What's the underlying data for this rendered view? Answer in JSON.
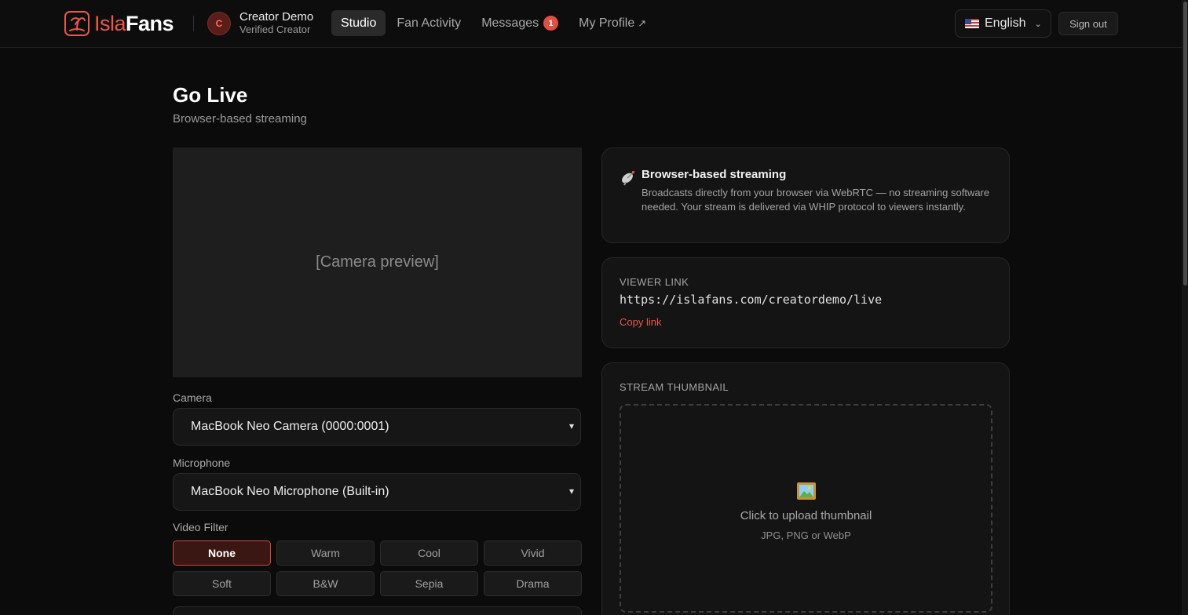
{
  "brand": {
    "part1": "Isla",
    "part2": "Fans"
  },
  "user": {
    "initial": "C",
    "name": "Creator Demo",
    "role": "Verified Creator"
  },
  "nav": {
    "studio": "Studio",
    "fan_activity": "Fan Activity",
    "messages": "Messages",
    "messages_count": "1",
    "my_profile": "My Profile",
    "external_arrow": "↗"
  },
  "language": {
    "selected": "English"
  },
  "signout": "Sign out",
  "page": {
    "title": "Go Live",
    "subtitle": "Browser-based streaming"
  },
  "preview": {
    "placeholder": "[Camera preview]"
  },
  "camera": {
    "label": "Camera",
    "selected": "MacBook Neo Camera (0000:0001)"
  },
  "microphone": {
    "label": "Microphone",
    "selected": "MacBook Neo Microphone (Built-in)"
  },
  "video_filter": {
    "label": "Video Filter",
    "options": [
      "None",
      "Warm",
      "Cool",
      "Vivid",
      "Soft",
      "B&W",
      "Sepia",
      "Drama"
    ],
    "selected": "None"
  },
  "info_card": {
    "title": "Browser-based streaming",
    "text": "Broadcasts directly from your browser via WebRTC — no streaming software needed. Your stream is delivered via WHIP protocol to viewers instantly."
  },
  "viewer_link": {
    "label": "Viewer Link",
    "url": "https://islafans.com/creatordemo/live",
    "copy": "Copy link"
  },
  "thumbnail": {
    "label": "Stream Thumbnail",
    "cta": "Click to upload thumbnail",
    "hint": "JPG, PNG or WebP"
  },
  "colors": {
    "accent": "#e8574a",
    "background": "#0b0b0b",
    "card": "#141414"
  }
}
